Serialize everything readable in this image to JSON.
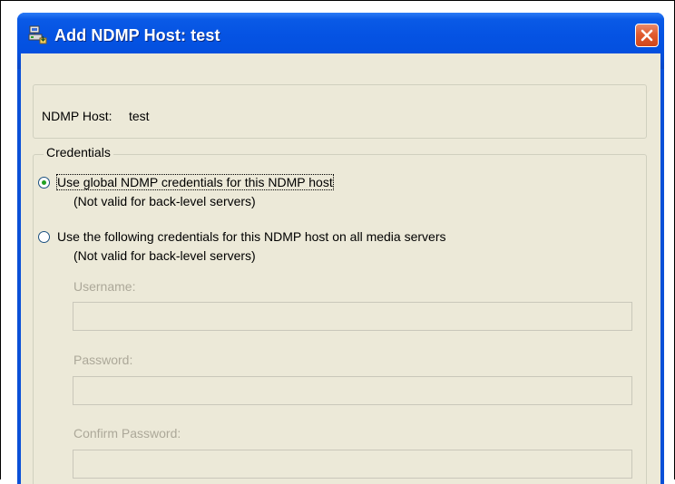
{
  "window": {
    "title": "Add NDMP Host: test",
    "icons": {
      "title_icon": "ndmp-host-icon",
      "close": "close-icon"
    }
  },
  "host": {
    "label": "NDMP Host:",
    "value": "test"
  },
  "credentials": {
    "legend": "Credentials",
    "options": [
      {
        "label": "Use global NDMP credentials for this NDMP host",
        "note": "(Not valid for back-level servers)",
        "selected": true
      },
      {
        "label": "Use the following credentials for this NDMP host on all media servers",
        "note": "(Not valid for back-level servers)",
        "selected": false
      }
    ],
    "fields": {
      "username": {
        "label": "Username:",
        "value": ""
      },
      "password": {
        "label": "Password:",
        "value": ""
      },
      "confirm_password": {
        "label": "Confirm Password:",
        "value": ""
      }
    }
  },
  "colors": {
    "titlebar": "#0553e3",
    "client_bg": "#ece9d8",
    "disabled_text": "#aca899",
    "close_button": "#e15b2e",
    "radio_dot": "#21a121"
  }
}
